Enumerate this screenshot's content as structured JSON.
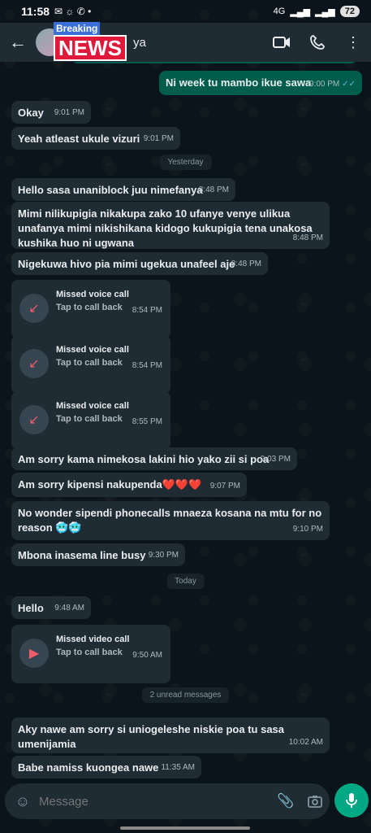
{
  "status_bar": {
    "time": "11:58",
    "network": "4G",
    "battery": "72"
  },
  "header": {
    "contact_name": "ya",
    "badge_small": "Breaking",
    "badge_big": "NEWS"
  },
  "messages": [
    {
      "type": "out",
      "text": "Ni week tu mambo ikue sawa",
      "time": "9:00 PM"
    },
    {
      "type": "in",
      "text": "Okay",
      "time": "9:01 PM"
    },
    {
      "type": "in",
      "text": "Yeah atleast ukule vizuri",
      "time": "9:01 PM"
    },
    {
      "type": "in",
      "text": "Hello sasa unaniblock juu nimefanya",
      "time": "8:48 PM"
    },
    {
      "type": "in",
      "text": "Mimi nilikupigia nikakupa zako 10 ufanye venye ulikua unafanya mimi nikishikana kidogo kukupigia tena unakosa kushika huo ni ugwana",
      "time": "8:48 PM"
    },
    {
      "type": "in",
      "text": "Nigekuwa hivo pia mimi ugekua unafeel aje",
      "time": "8:48 PM"
    },
    {
      "type": "in",
      "text": "Am sorry kama nimekosa lakini hio yako zii si poa",
      "time": "9:03 PM"
    },
    {
      "type": "in",
      "text": "Am sorry kipensi nakupenda❤️❤️❤️",
      "time": "9:07 PM"
    },
    {
      "type": "in",
      "text": "No wonder sipendi phonecalls mnaeza kosana na mtu for no reason 🥶🥶",
      "time": "9:10 PM"
    },
    {
      "type": "in",
      "text": "Mbona inasema line busy",
      "time": "9:30 PM"
    },
    {
      "type": "in",
      "text": "Hello",
      "time": "9:48 AM"
    },
    {
      "type": "in",
      "text": "Aky nawe am sorry si uniogeleshe niskie poa tu sasa umenijamia",
      "time": "10:02 AM"
    },
    {
      "type": "in",
      "text": "Babe namiss kuongea nawe",
      "time": "11:35 AM"
    }
  ],
  "calls": [
    {
      "title": "Missed voice call",
      "sub": "Tap to call back",
      "time": "8:54 PM"
    },
    {
      "title": "Missed voice call",
      "sub": "Tap to call back",
      "time": "8:54 PM"
    },
    {
      "title": "Missed voice call",
      "sub": "Tap to call back",
      "time": "8:55 PM"
    },
    {
      "title": "Missed video call",
      "sub": "Tap to call back",
      "time": "9:50 AM"
    }
  ],
  "dividers": {
    "yesterday": "Yesterday",
    "today": "Today",
    "unread": "2 unread messages"
  },
  "input": {
    "placeholder": "Message"
  },
  "colors": {
    "accent": "#00a884",
    "outgoing": "#005c4b",
    "incoming": "#202c33",
    "missed": "#f15c6d"
  }
}
